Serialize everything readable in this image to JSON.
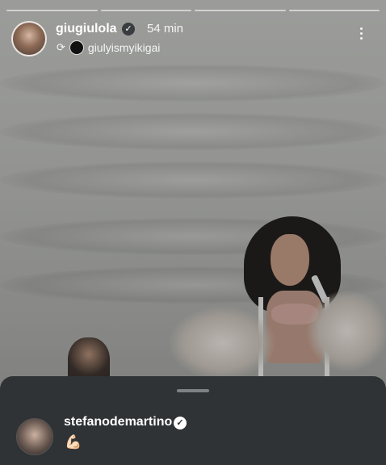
{
  "story": {
    "progress_segments": 4,
    "author": {
      "username": "giugiulola",
      "time": "54 min",
      "verified_icon": "check-badge-icon",
      "avatar_icon": "avatar"
    },
    "repost": {
      "icon": "repost-icon",
      "glyph": "⟳",
      "username": "giulyismyikigai"
    },
    "menu_icon": "more-vertical-icon"
  },
  "comments_sheet": {
    "handle": "drag-handle",
    "comment": {
      "username": "stefanodemartino",
      "verified_glyph": "✓",
      "text": "💪🏻"
    }
  },
  "colors": {
    "sheet_bg": "#2f3336",
    "text": "#ffffff",
    "muted": "#f4f4f4"
  }
}
